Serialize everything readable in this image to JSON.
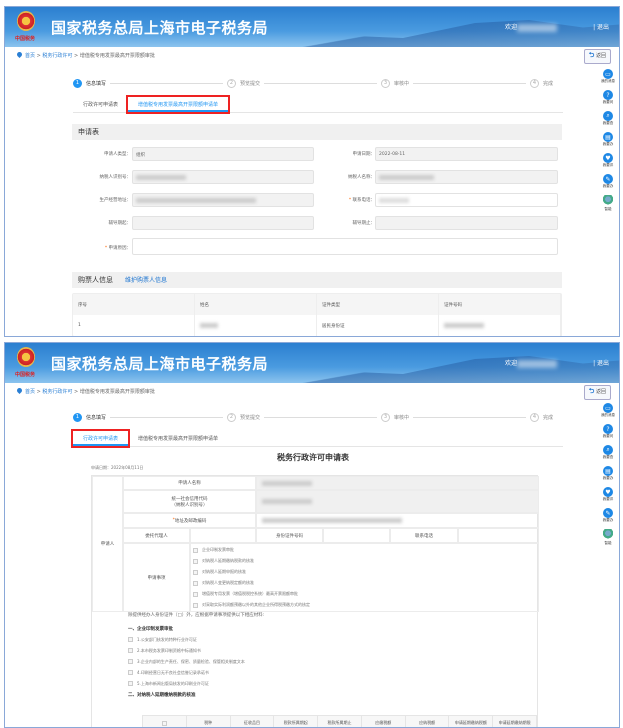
{
  "header": {
    "title": "国家税务总局上海市电子税务局",
    "logo_text": "中国税务",
    "welcome": "欢迎",
    "logout": "| 退出"
  },
  "breadcrumb": {
    "home": "首页",
    "sep": ">",
    "level1": "税务行政许可",
    "current": "增值税专用发票最高开票限额审批"
  },
  "back_label": "返回",
  "steps": [
    {
      "num": "1",
      "label": "信息填写"
    },
    {
      "num": "2",
      "label": "预览提交"
    },
    {
      "num": "3",
      "label": "审核中"
    },
    {
      "num": "4",
      "label": "完成"
    }
  ],
  "tabs": [
    "行政许可申请表",
    "增值税专用发票最高开票限额申请单"
  ],
  "sidebar": [
    "我的消息",
    "我要问",
    "我要查",
    "我要办",
    "我要评",
    "我要办",
    "智能"
  ],
  "top": {
    "section1": "申请表",
    "fields": {
      "applicant_type_label": "申请人类型：",
      "applicant_type": "组织",
      "apply_date_label": "申请日期：",
      "apply_date": "2022-08-11",
      "taxpayer_id_label": "纳税人识别号：",
      "taxpayer_name_label": "纳税人名称：",
      "address_label": "生产经营地址：",
      "phone_label": "联系电话：",
      "coach_start_label": "辅导期起：",
      "coach_end_label": "辅导期止：",
      "reason_label": "申请原因："
    },
    "section2": "购票人信息",
    "section2_link": "维护购票人信息",
    "table": {
      "headers": [
        "序号",
        "姓名",
        "证件类型",
        "证件号码"
      ],
      "rows": [
        [
          "1",
          "",
          "居民身份证",
          ""
        ]
      ]
    }
  },
  "bottom": {
    "form_title": "税务行政许可申请表",
    "apply_date": "申请日期：2022年08月11日",
    "applicant": "申请人",
    "name_label": "申请人名称",
    "credit_code_label": "统一社会信用代码",
    "credit_code_sub": "（纳税人识别号）",
    "address_label": "地址及邮政编码",
    "agent_label": "委托代理人",
    "id_label": "身份证件号码",
    "phone_label": "联系电话",
    "matters_label": "申请事项",
    "matters": [
      "企业印制发票审批",
      "对纳税人延期缴纳税款的核准",
      "对纳税人延期申报的核准",
      "对纳税人变更纳税定额的核准",
      "增值税专用发票（增值税税控系统）最高开票限额审批",
      "对采取实际利润额预缴以外的其他企业所得税预缴方式的核定"
    ],
    "materials_intro": "除提供经办人身份证件（□）外，应根据申请事项提供以下相应材料:",
    "group1": "一、企业印制发票审批",
    "group1_items": [
      "1.公安部门核发的特种行业许可证",
      "2.本市税务发票印制资格中标通知书",
      "3.企业内部的生产责任、保密、质量检验、保管相关制度文本",
      "4.印刷经营日无不良社会信誉记录承诺书",
      "5.上海市新闻出版局核发的印刷业许可证"
    ],
    "group2": "二、对纳税人延期缴纳税款的核准",
    "group2_headers": [
      "税种",
      "征收品目",
      "税款所属期起",
      "税款所属期止",
      "应缴税额",
      "应纳税额",
      "申请延期缴纳税额",
      "申请延期缴纳期限"
    ]
  }
}
